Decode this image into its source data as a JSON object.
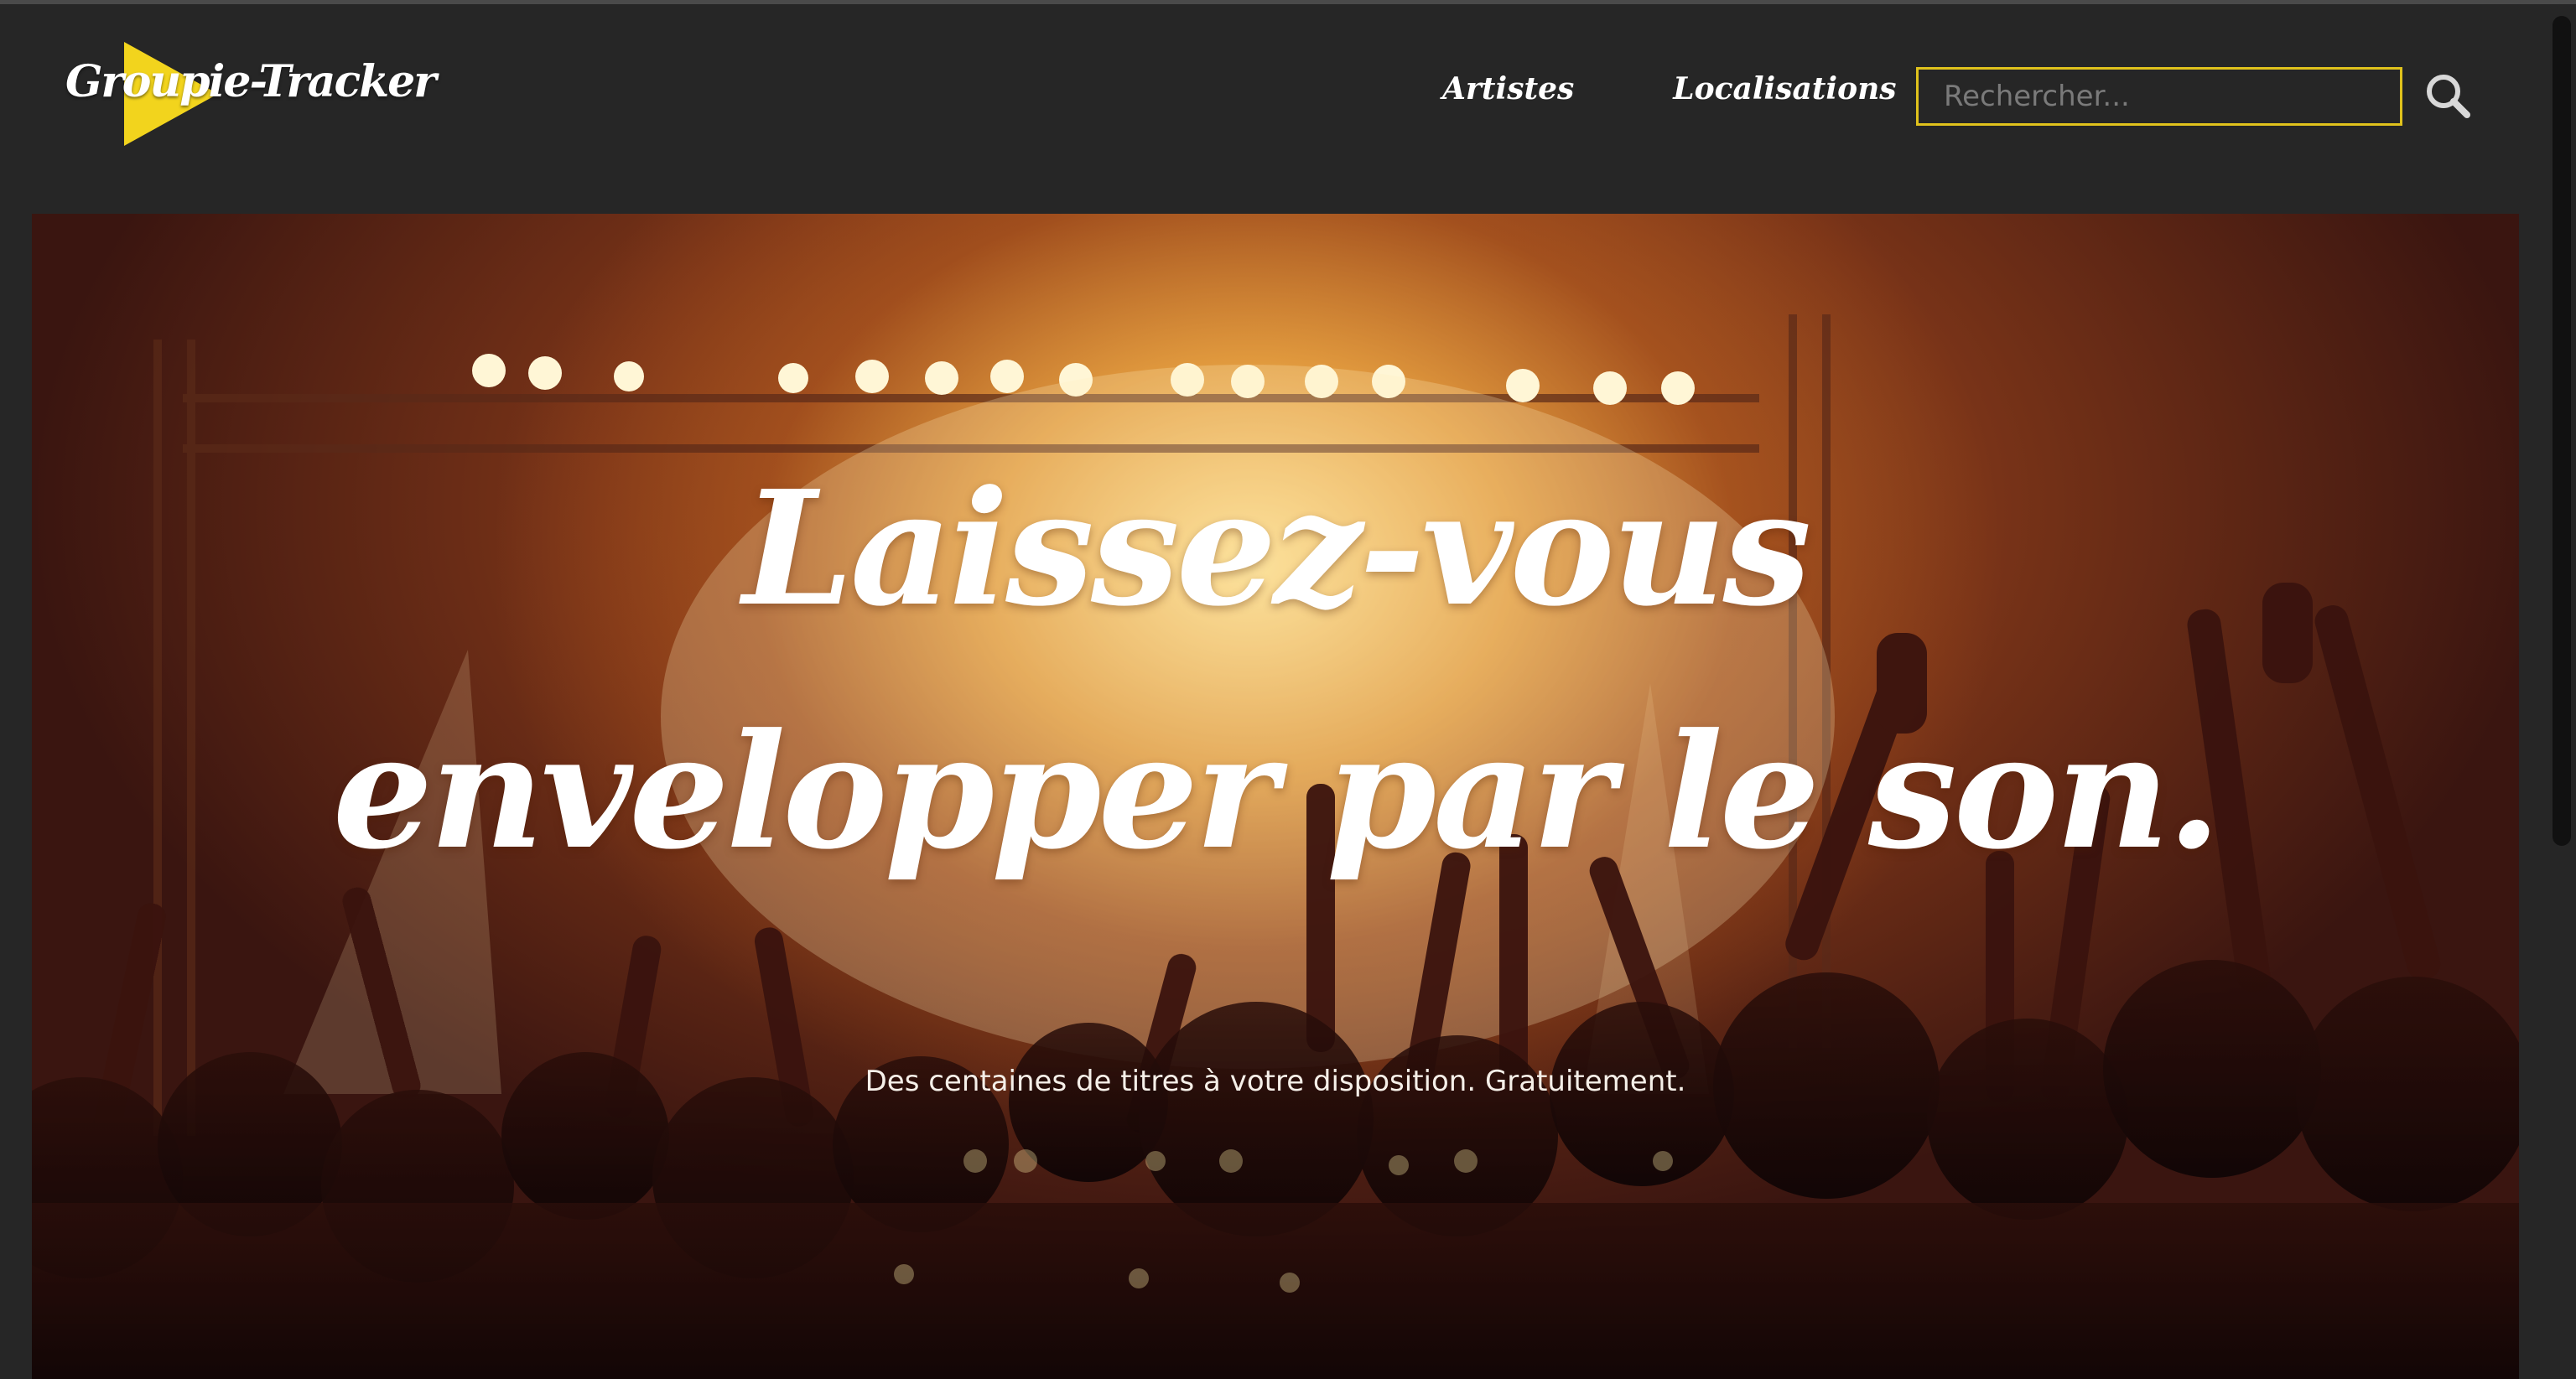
{
  "header": {
    "logo": {
      "part1": "Groupie-",
      "part2": "Tracker",
      "accent_color": "#f2d41d"
    },
    "nav": [
      {
        "label": "Artistes"
      },
      {
        "label": "Localisations"
      }
    ],
    "search": {
      "placeholder": "Rechercher...",
      "value": "",
      "icon": "search-icon"
    }
  },
  "hero": {
    "title": "Laissez-vous envelopper par le son.",
    "subtitle": "Des centaines de titres à votre disposition. Gratuitement."
  },
  "colors": {
    "background": "#262626",
    "accent": "#e0c21c",
    "text": "#ffffff"
  }
}
